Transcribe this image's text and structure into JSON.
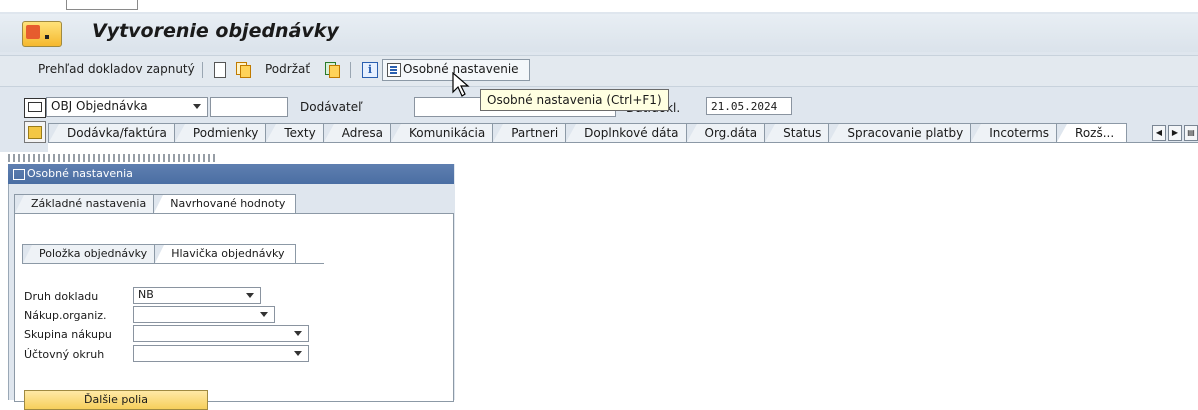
{
  "header": {
    "title": "Vytvorenie objednávky"
  },
  "toolbar": {
    "doc_overview": "Prehľad dokladov zapnutý",
    "hold": "Podržať",
    "personal_settings": "Osobné nastavenie"
  },
  "tooltip": {
    "text": "Osobné nastavenia  (Ctrl+F1)"
  },
  "order_header": {
    "order_type": "OBJ Objednávka",
    "vendor_label": "Dodávateľ",
    "doc_date_label_partial": "Dát.dokl.",
    "doc_date_value": "21.05.2024"
  },
  "tabs": [
    "Dodávka/faktúra",
    "Podmienky",
    "Texty",
    "Adresa",
    "Komunikácia",
    "Partneri",
    "Doplnkové dáta",
    "Org.dáta",
    "Status",
    "Spracovanie platby",
    "Incoterms",
    "Rozš..."
  ],
  "dialog": {
    "title": "Osobné nastavenia",
    "tabs": [
      "Základné nastavenia",
      "Navrhované hodnoty"
    ],
    "subtabs": [
      "Položka objednávky",
      "Hlavička objednávky"
    ],
    "fields": [
      {
        "label": "Druh dokladu",
        "value": "NB"
      },
      {
        "label": "Nákup.organiz.",
        "value": ""
      },
      {
        "label": "Skupina nákupu",
        "value": ""
      },
      {
        "label": "Účtovný okruh",
        "value": ""
      }
    ],
    "more_button": "Ďalšie polia"
  }
}
